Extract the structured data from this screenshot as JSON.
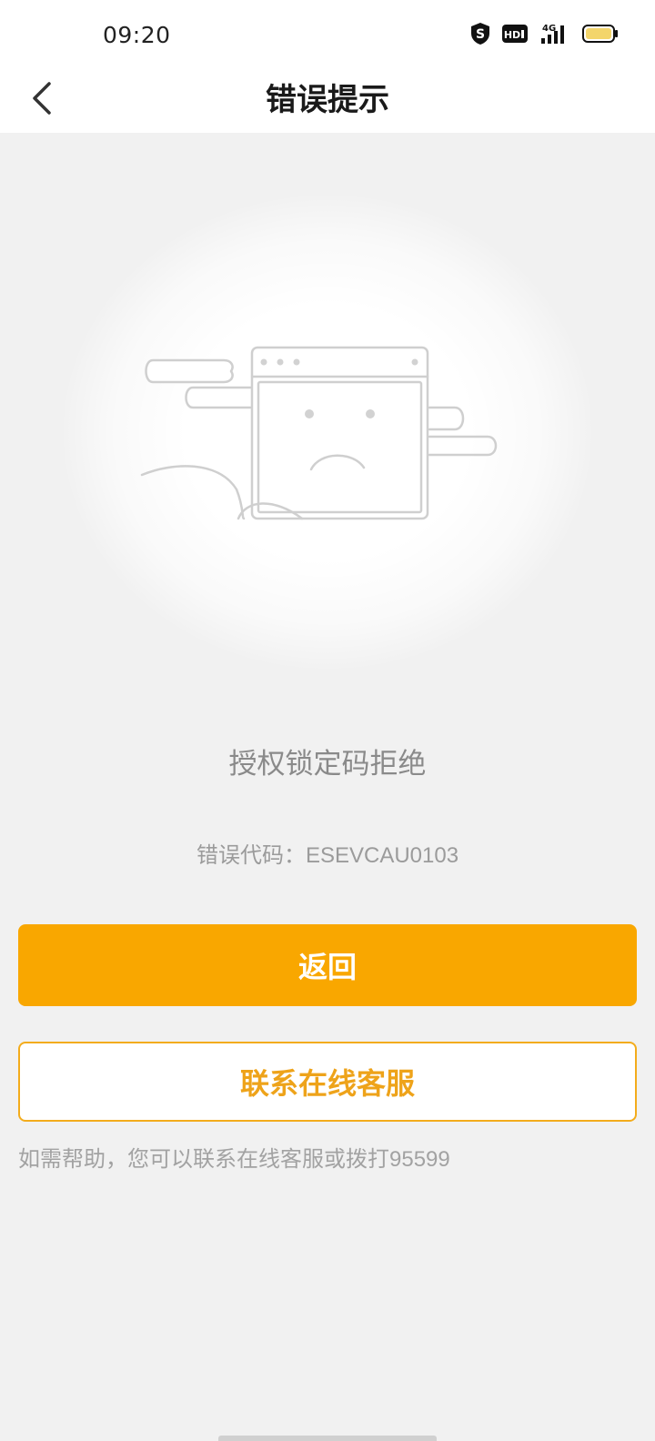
{
  "status_bar": {
    "time": "09:20",
    "icons": [
      "shield-s-icon",
      "hd-icon",
      "4g-signal-icon",
      "battery-icon"
    ],
    "hd_label": "HD",
    "network_label": "4G"
  },
  "nav": {
    "title": "错误提示",
    "back_icon": "chevron-left-icon"
  },
  "illustration": {
    "icon": "sad-browser-window-icon"
  },
  "error": {
    "message": "授权锁定码拒绝",
    "code_label": "错误代码：",
    "code_value": "ESEVCAU0103"
  },
  "actions": {
    "back_label": "返回",
    "contact_label": "联系在线客服"
  },
  "help": {
    "text": "如需帮助，您可以联系在线客服或拨打",
    "phone": "95599"
  },
  "colors": {
    "accent": "#f9a700",
    "accent_text": "#eea31a",
    "background": "#f1f1f1"
  }
}
